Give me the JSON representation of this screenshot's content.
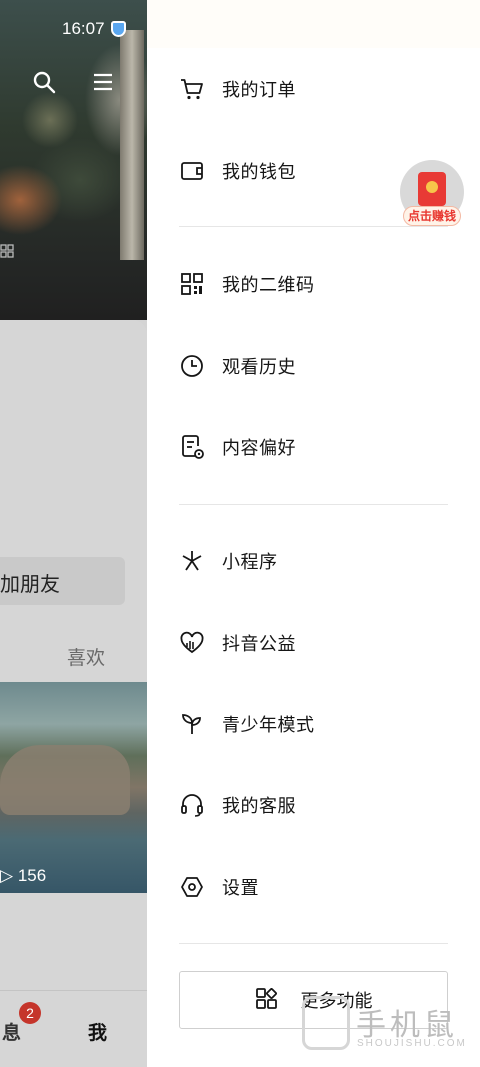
{
  "status_bar": {
    "time": "16:07"
  },
  "background": {
    "add_friend_label": "加朋友",
    "likes_tab_label": "喜欢",
    "video_play_count": "156",
    "bottom_nav": {
      "messages_label": "息",
      "messages_badge": "2",
      "me_label": "我"
    }
  },
  "drawer": {
    "group1": [
      {
        "label": "我的订单",
        "icon": "cart-icon"
      },
      {
        "label": "我的钱包",
        "icon": "wallet-icon"
      }
    ],
    "red_packet_label": "点击赚钱",
    "group2": [
      {
        "label": "我的二维码",
        "icon": "qr-code-icon"
      },
      {
        "label": "观看历史",
        "icon": "clock-icon"
      },
      {
        "label": "内容偏好",
        "icon": "preference-icon"
      }
    ],
    "group3": [
      {
        "label": "小程序",
        "icon": "mini-program-icon"
      },
      {
        "label": "抖音公益",
        "icon": "charity-heart-icon"
      },
      {
        "label": "青少年模式",
        "icon": "sprout-icon"
      },
      {
        "label": "我的客服",
        "icon": "headset-icon"
      },
      {
        "label": "设置",
        "icon": "settings-hexagon-icon"
      }
    ],
    "more_features_label": "更多功能"
  },
  "watermark": {
    "text": "手机鼠",
    "sub": "SHOUJISHU.COM"
  }
}
